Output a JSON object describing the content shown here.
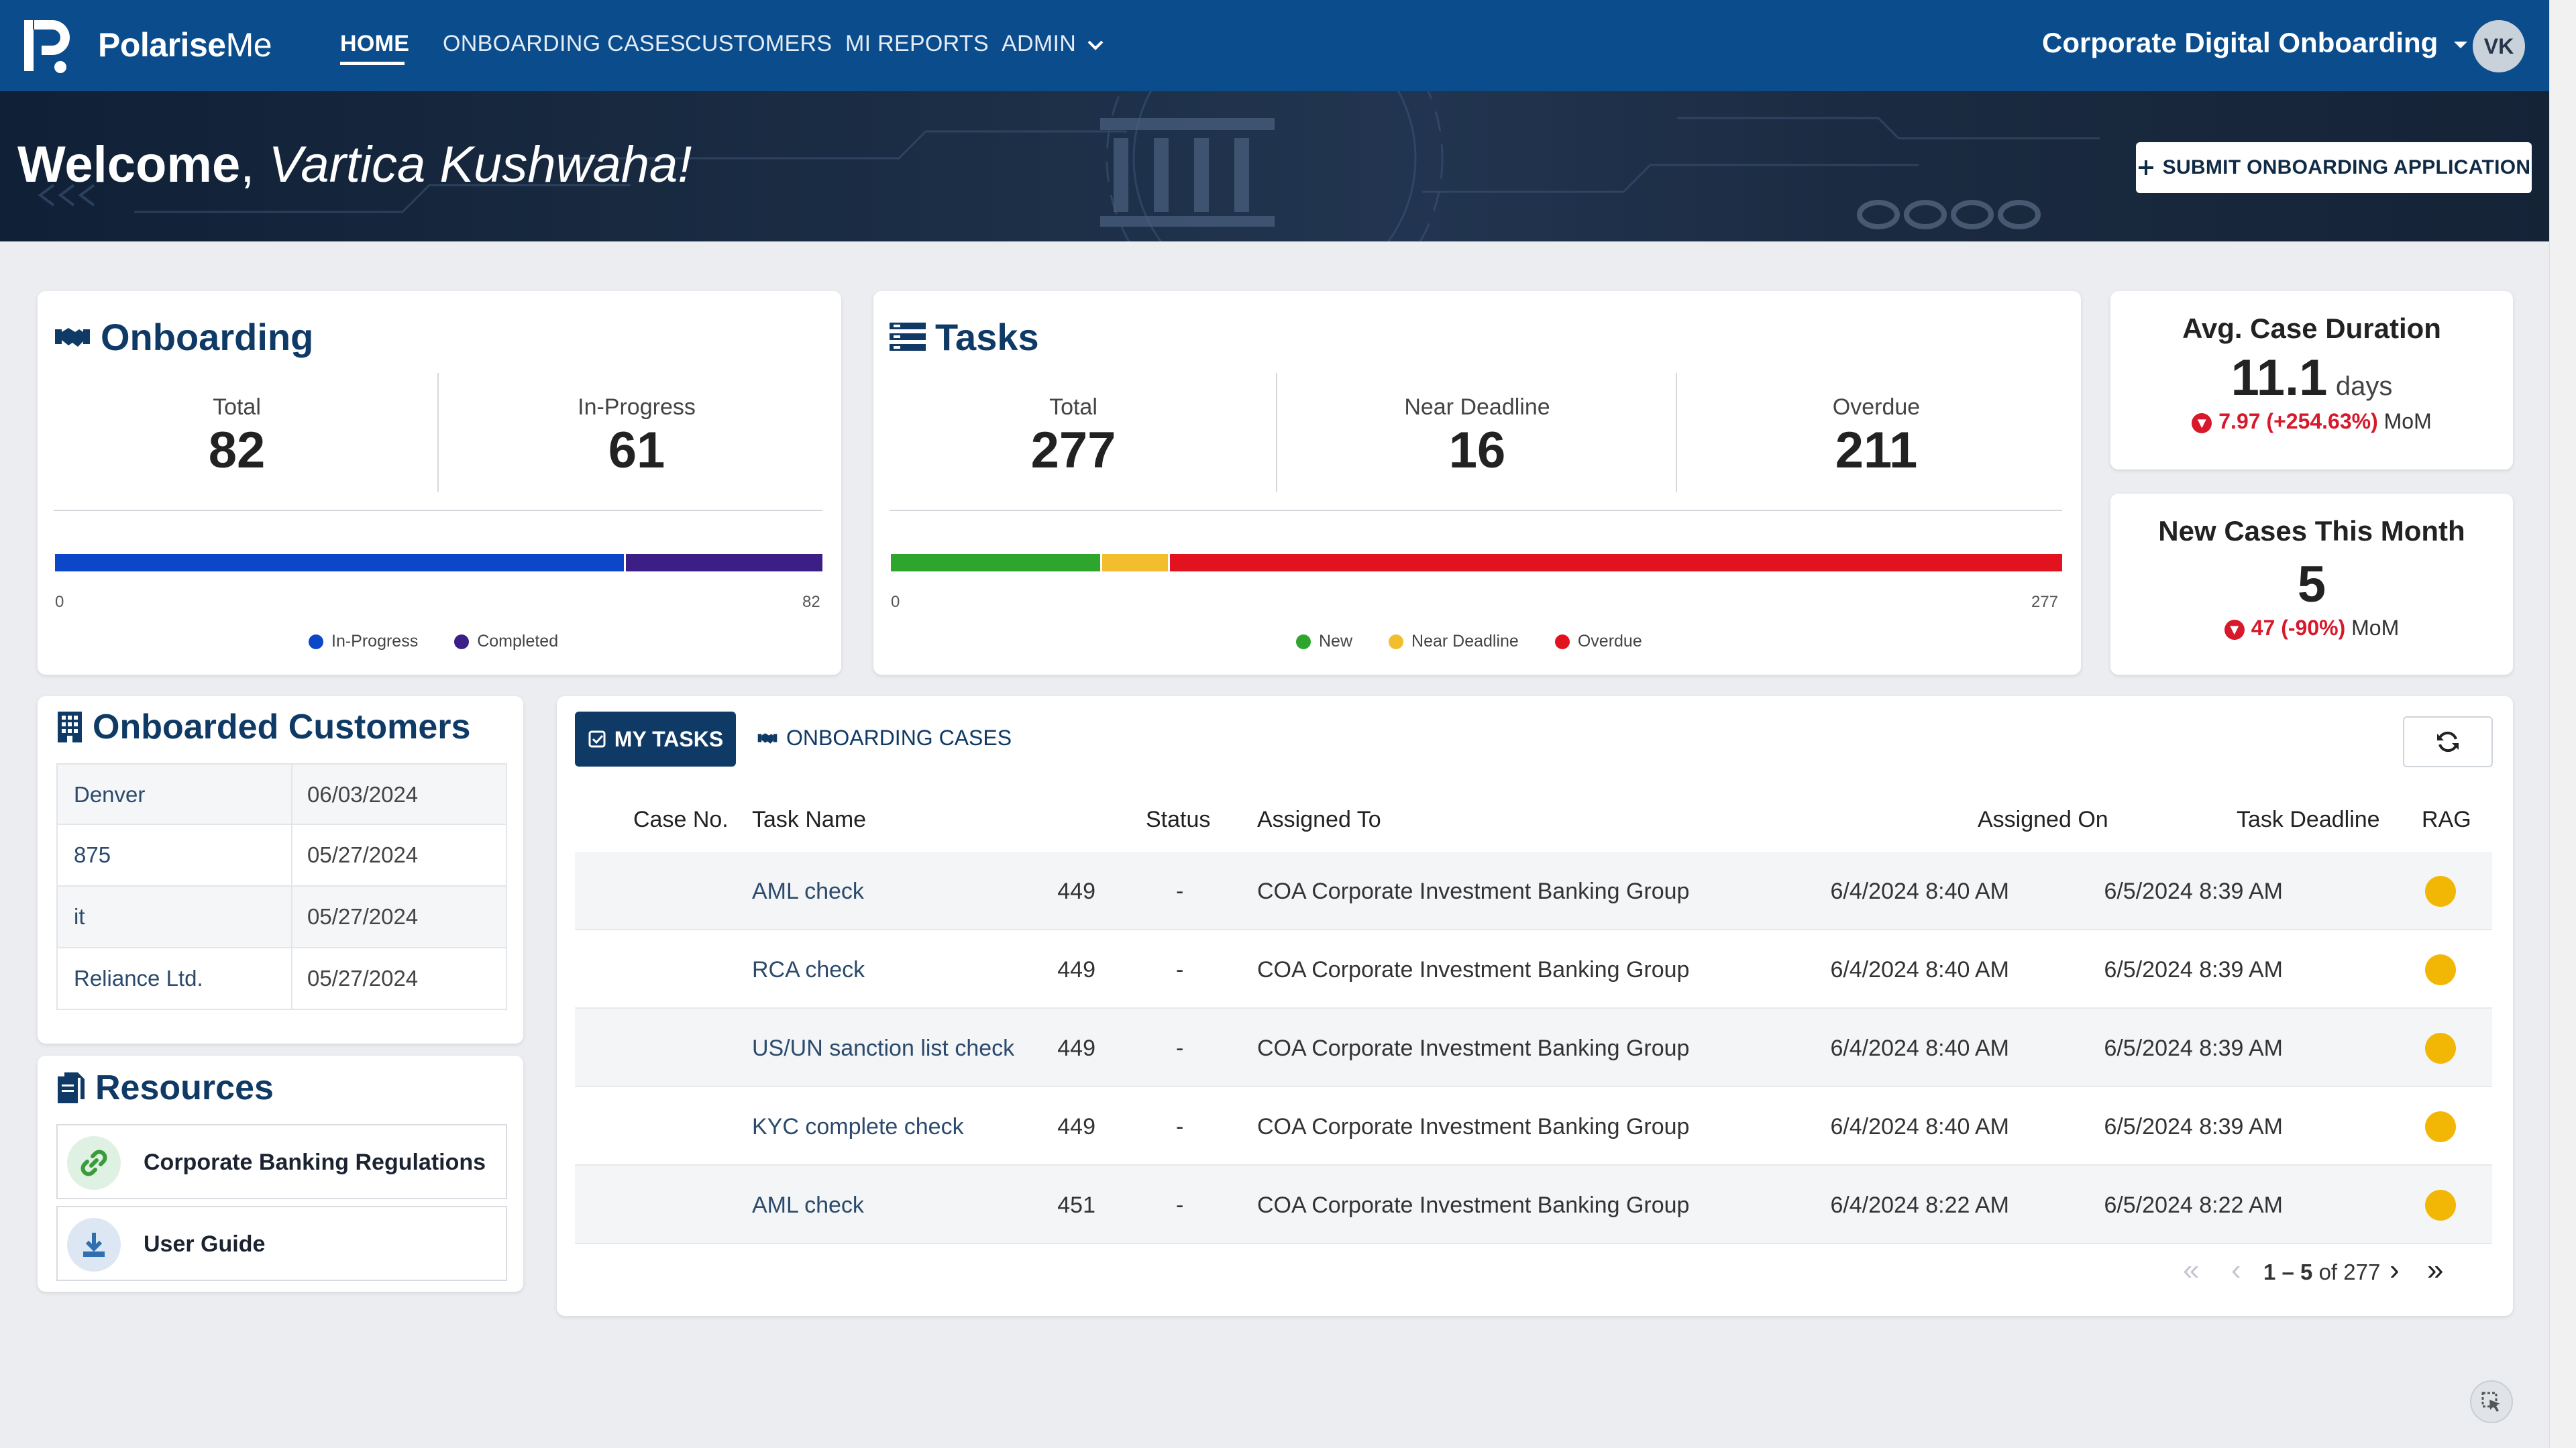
{
  "nav": {
    "brand_main": "Polarise",
    "brand_suffix": "Me",
    "items": [
      {
        "label": "HOME"
      },
      {
        "label": "ONBOARDING CASES"
      },
      {
        "label": "CUSTOMERS"
      },
      {
        "label": "MI REPORTS"
      },
      {
        "label": "ADMIN"
      }
    ],
    "org": "Corporate Digital Onboarding",
    "avatar": "VK"
  },
  "banner": {
    "welcome": "Welcome",
    "comma": ",",
    "user_name": "Vartica Kushwaha!",
    "submit_label": "SUBMIT ONBOARDING APPLICATION"
  },
  "onboarding": {
    "title": "Onboarding",
    "total_label": "Total",
    "total": "82",
    "inprogress_label": "In-Progress",
    "inprogress": "61",
    "axis_min": "0",
    "axis_max": "82",
    "legend": [
      "In-Progress",
      "Completed"
    ],
    "segments": {
      "in_progress": 61,
      "completed": 21
    }
  },
  "tasks_summary": {
    "title": "Tasks",
    "total_label": "Total",
    "total": "277",
    "near_label": "Near Deadline",
    "near": "16",
    "overdue_label": "Overdue",
    "overdue": "211",
    "axis_min": "0",
    "axis_max": "277",
    "legend": [
      "New",
      "Near Deadline",
      "Overdue"
    ],
    "segments": {
      "new": 50,
      "near_deadline": 16,
      "overdue": 211
    }
  },
  "kpis": {
    "avg_title": "Avg. Case Duration",
    "avg_value": "11.1",
    "avg_unit": "days",
    "avg_change": "7.97 (+254.63%)",
    "avg_suffix": "MoM",
    "new_title": "New Cases This Month",
    "new_value": "5",
    "new_change": "47 (-90%)",
    "new_suffix": "MoM"
  },
  "customers": {
    "title": "Onboarded Customers",
    "rows": [
      {
        "name": "Denver",
        "date": "06/03/2024"
      },
      {
        "name": "875",
        "date": "05/27/2024"
      },
      {
        "name": "it",
        "date": "05/27/2024"
      },
      {
        "name": "Reliance Ltd.",
        "date": "05/27/2024"
      }
    ]
  },
  "resources": {
    "title": "Resources",
    "items": [
      {
        "label": "Corporate Banking Regulations",
        "icon": "link-icon"
      },
      {
        "label": "User Guide",
        "icon": "download-icon"
      }
    ]
  },
  "tasks_table": {
    "tab_mytasks": "MY TASKS",
    "tab_cases": "ONBOARDING CASES",
    "headers": {
      "case_no": "Case No.",
      "task_name": "Task Name",
      "status": "Status",
      "assigned_to": "Assigned To",
      "assigned_on": "Assigned On",
      "deadline": "Task Deadline",
      "rag": "RAG"
    },
    "rows": [
      {
        "case": "449",
        "task": "AML check",
        "status": "-",
        "assigned_to": "COA Corporate Investment Banking Group",
        "assigned_on": "6/4/2024 8:40 AM",
        "deadline": "6/5/2024 8:39 AM",
        "rag": "amber"
      },
      {
        "case": "449",
        "task": "RCA check",
        "status": "-",
        "assigned_to": "COA Corporate Investment Banking Group",
        "assigned_on": "6/4/2024 8:40 AM",
        "deadline": "6/5/2024 8:39 AM",
        "rag": "amber"
      },
      {
        "case": "449",
        "task": "US/UN sanction list check",
        "status": "-",
        "assigned_to": "COA Corporate Investment Banking Group",
        "assigned_on": "6/4/2024 8:40 AM",
        "deadline": "6/5/2024 8:39 AM",
        "rag": "amber"
      },
      {
        "case": "449",
        "task": "KYC complete check",
        "status": "-",
        "assigned_to": "COA Corporate Investment Banking Group",
        "assigned_on": "6/4/2024 8:40 AM",
        "deadline": "6/5/2024 8:39 AM",
        "rag": "amber"
      },
      {
        "case": "451",
        "task": "AML check",
        "status": "-",
        "assigned_to": "COA Corporate Investment Banking Group",
        "assigned_on": "6/4/2024 8:22 AM",
        "deadline": "6/5/2024 8:22 AM",
        "rag": "amber"
      }
    ],
    "pager_range": "1 – 5",
    "pager_of": "of 277"
  },
  "colors": {
    "nav": "#0b4c8c",
    "accent": "#0f3a66",
    "in_progress": "#0d47c9",
    "completed": "#3b1f86",
    "new": "#2ea52d",
    "near_deadline": "#f2be2e",
    "overdue": "#e3121f",
    "amber": "#f2b705"
  }
}
